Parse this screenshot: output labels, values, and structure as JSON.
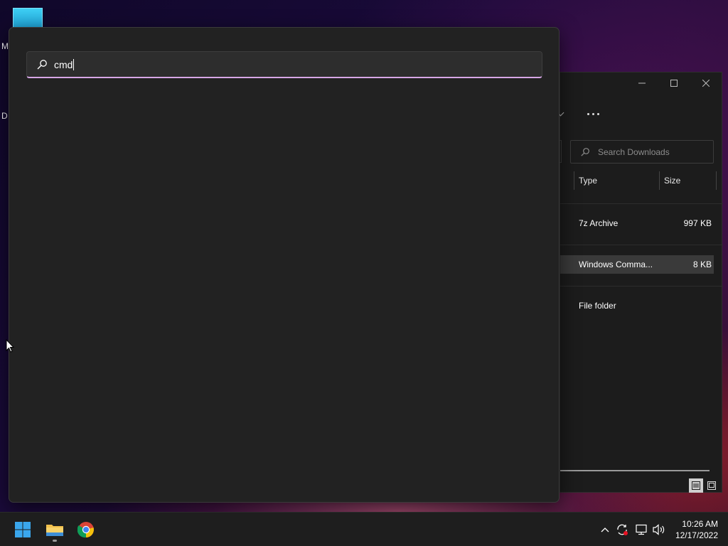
{
  "desktop": {
    "icon_label_partial_1": "M",
    "icon_label_partial_2": "D"
  },
  "explorer": {
    "search_placeholder": "Search Downloads",
    "columns": [
      "Type",
      "Size"
    ],
    "rows": [
      {
        "type": "7z Archive",
        "size": "997 KB",
        "selected": false
      },
      {
        "type": "Windows Comma...",
        "size": "8 KB",
        "selected": true
      },
      {
        "type": "File folder",
        "size": "",
        "selected": false
      }
    ]
  },
  "search": {
    "query": "cmd"
  },
  "taskbar": {
    "apps": [
      "start-icon",
      "file-explorer-icon",
      "chrome-icon"
    ],
    "time": "10:26 AM",
    "date": "12/17/2022"
  },
  "colors": {
    "accent_underline": "#d7a6e6",
    "flyout_bg": "#222222"
  }
}
